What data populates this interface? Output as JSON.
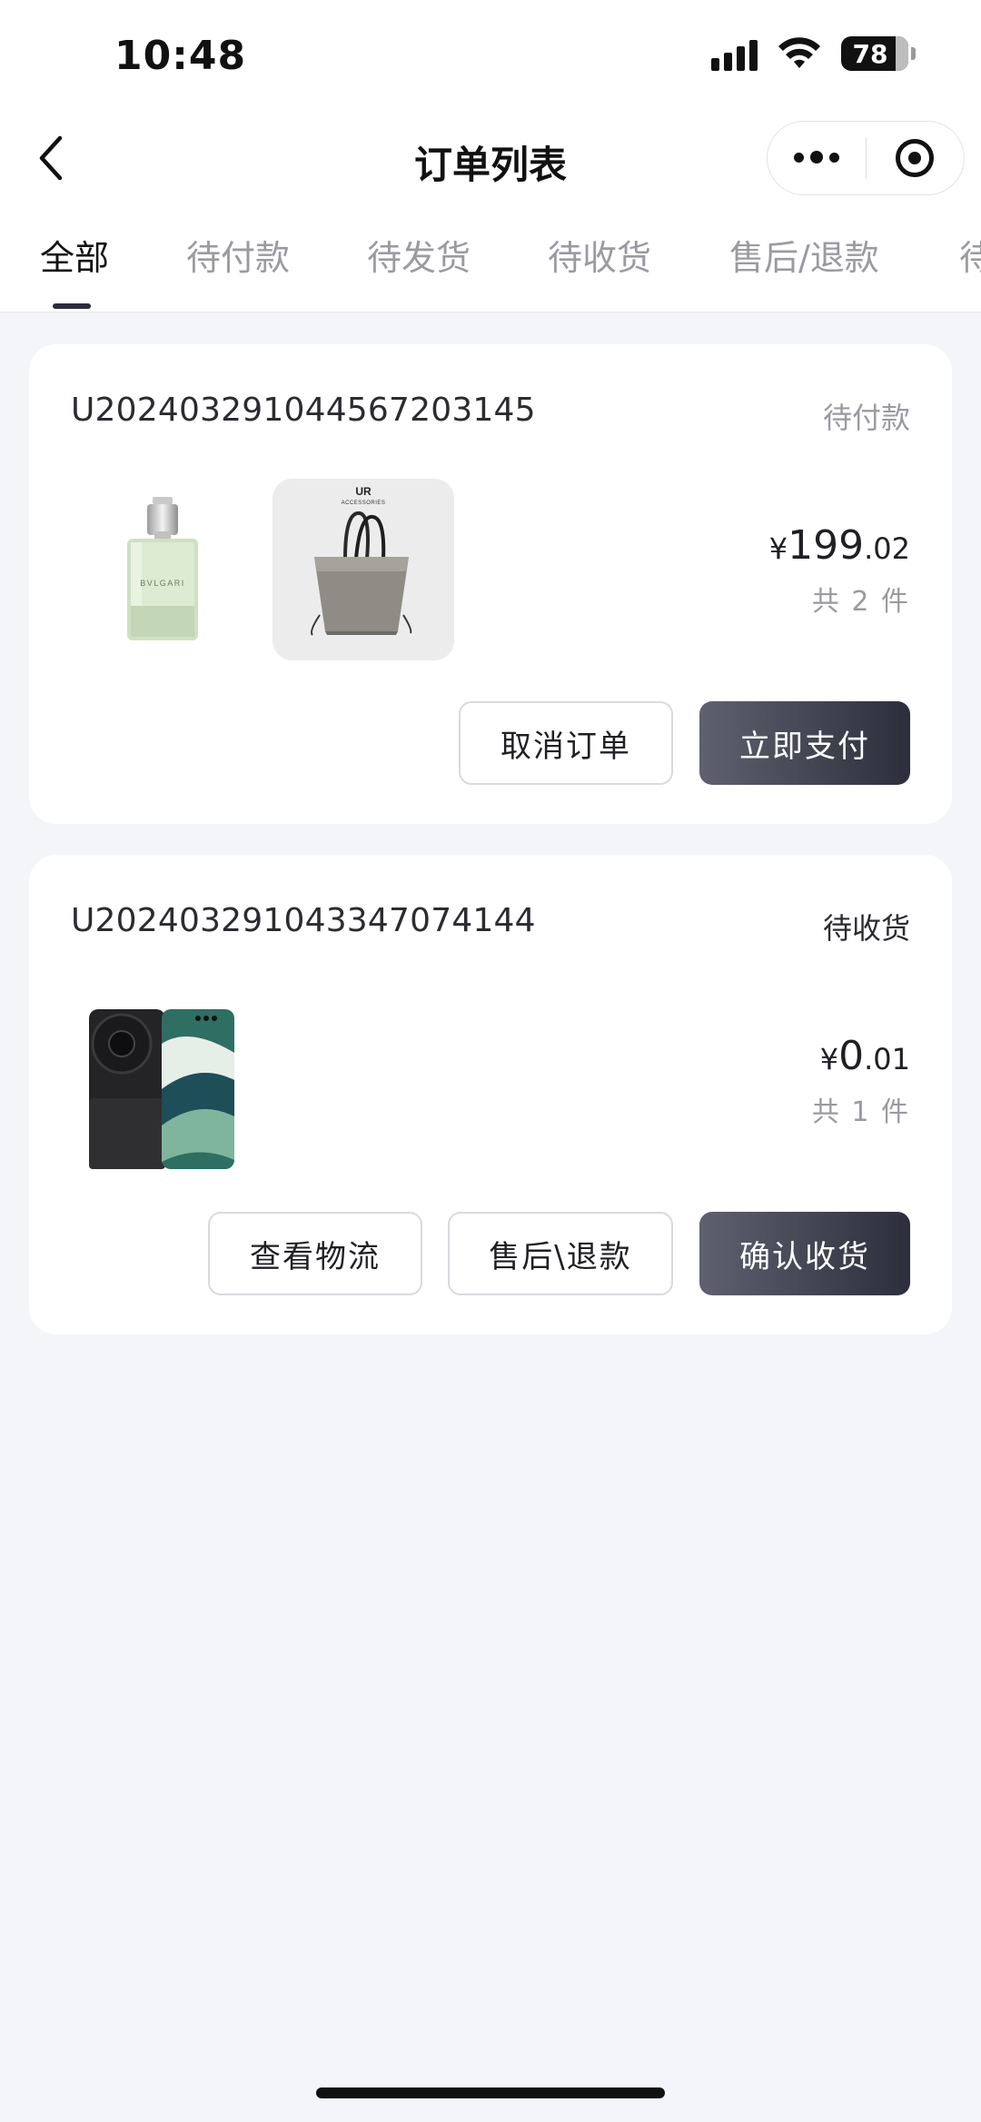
{
  "status_bar": {
    "time": "10:48",
    "battery": "78"
  },
  "nav": {
    "title": "订单列表"
  },
  "tabs": [
    {
      "label": "全部",
      "active": true
    },
    {
      "label": "待付款",
      "active": false
    },
    {
      "label": "待发货",
      "active": false
    },
    {
      "label": "待收货",
      "active": false
    },
    {
      "label": "售后/退款",
      "active": false
    },
    {
      "label": "待",
      "active": false
    }
  ],
  "orders": [
    {
      "order_no": "U20240329104456720 3145",
      "order_no_clean": "U202403291044567203145",
      "status": "待付款",
      "status_color": "#9a9aa2",
      "products": [
        {
          "name": "perfume-bottle",
          "label": "BVLGARI"
        },
        {
          "name": "tote-bag",
          "brand": "UR",
          "sub": "ACCESSORIES"
        }
      ],
      "price_currency": "¥",
      "price_int": "199",
      "price_dec": ".02",
      "quantity": "共 2 件",
      "buttons": [
        {
          "label": "取消订单",
          "style": "outline"
        },
        {
          "label": "立即支付",
          "style": "dark"
        }
      ]
    },
    {
      "order_no": "U202403291043347074144",
      "status": "待收货",
      "status_color": "#2b2b30",
      "products": [
        {
          "name": "smartphone"
        }
      ],
      "price_currency": "¥",
      "price_int": "0",
      "price_dec": ".01",
      "quantity": "共 1 件",
      "buttons": [
        {
          "label": "查看物流",
          "style": "outline"
        },
        {
          "label": "售后\\退款",
          "style": "outline"
        },
        {
          "label": "确认收货",
          "style": "dark"
        }
      ]
    }
  ]
}
